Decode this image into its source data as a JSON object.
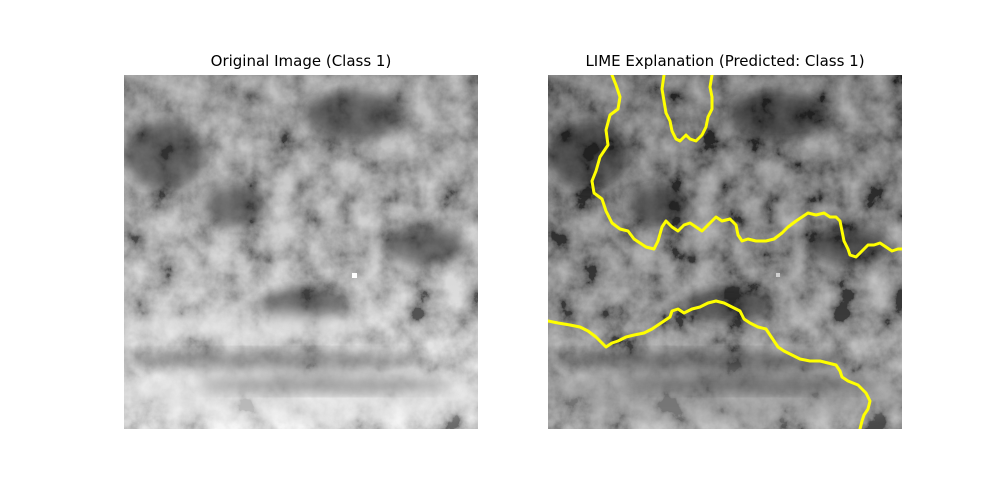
{
  "figure": {
    "panels": [
      {
        "title": "Original Image (Class 1)",
        "content": "grayscale satellite cloud image"
      },
      {
        "title": "LIME Explanation (Predicted: Class 1)",
        "content": "same image, slightly darkened, with yellow LIME superpixel boundaries",
        "boundary_color": "#ffff00"
      }
    ]
  }
}
